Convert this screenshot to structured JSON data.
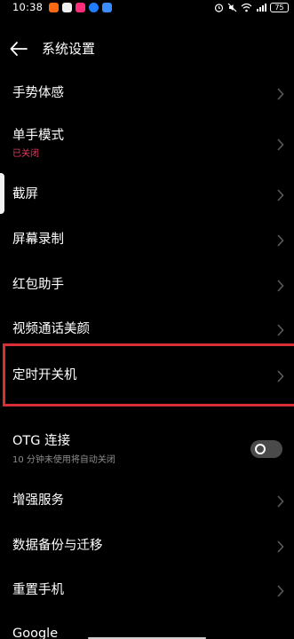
{
  "status_bar": {
    "time": "10:38",
    "app_icons": [
      "app-icon-orange",
      "app-icon-chat",
      "app-icon-pink",
      "app-icon-blue",
      "app-icon-blue-2"
    ],
    "battery": "75"
  },
  "header": {
    "title": "系统设置"
  },
  "items": [
    {
      "label": "手势体感"
    },
    {
      "label": "单手模式",
      "sub": "已关闭"
    },
    {
      "label": "截屏"
    },
    {
      "label": "屏幕录制"
    },
    {
      "label": "红包助手"
    },
    {
      "label": "视频通话美颜"
    },
    {
      "label": "定时开关机"
    },
    {
      "label": "OTG 连接",
      "sub": "10 分钟未使用将自动关闭",
      "toggle": "off"
    },
    {
      "label": "增强服务"
    },
    {
      "label": "数据备份与迁移"
    },
    {
      "label": "重置手机"
    },
    {
      "label": "Google"
    }
  ],
  "colors": {
    "background": "#000000",
    "accent_sub": "#e83a5f",
    "secondary_text": "#8c8c8c",
    "highlight_border": "#d72f33",
    "chevron": "#5a5a5a"
  }
}
